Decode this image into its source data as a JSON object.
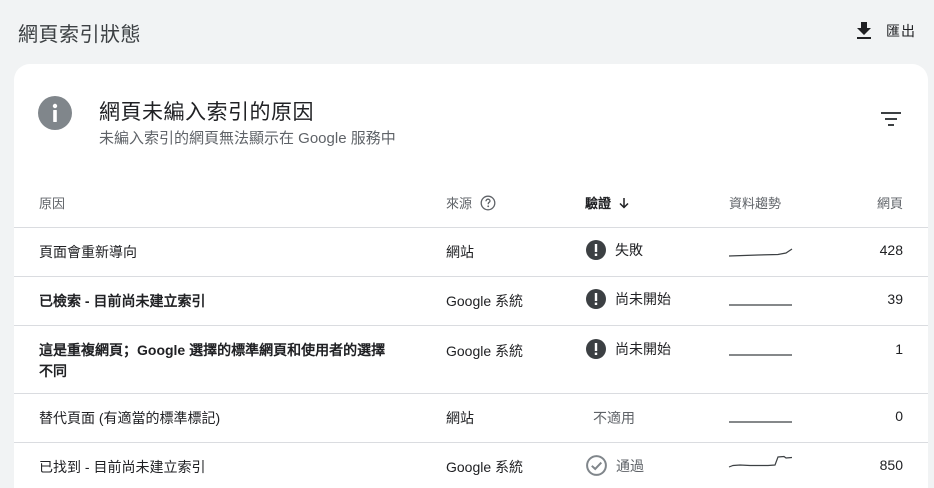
{
  "header": {
    "title": "網頁索引狀態",
    "export_label": "匯出"
  },
  "card": {
    "title": "網頁未編入索引的原因",
    "subtitle": "未編入索引的網頁無法顯示在 Google 服務中"
  },
  "table": {
    "columns": {
      "reason": "原因",
      "source": "來源",
      "verify": "驗證",
      "trend": "資料趨勢",
      "pages": "網頁"
    },
    "rows": [
      {
        "reason": "頁面會重新導向",
        "source": "網站",
        "verify": "失敗",
        "verify_status": "failed",
        "pages": "428",
        "bold": false
      },
      {
        "reason": "已檢索 - 目前尚未建立索引",
        "source": "Google 系統",
        "verify": "尚未開始",
        "verify_status": "not-started",
        "pages": "39",
        "bold": true
      },
      {
        "reason": "這是重複網頁；Google 選擇的標準網頁和使用者的選擇不同",
        "source": "Google 系統",
        "verify": "尚未開始",
        "verify_status": "not-started",
        "pages": "1",
        "bold": true
      },
      {
        "reason": "替代頁面 (有適當的標準標記)",
        "source": "網站",
        "verify": "不適用",
        "verify_status": "not-applicable",
        "pages": "0",
        "bold": false
      },
      {
        "reason": "已找到 - 目前尚未建立索引",
        "source": "Google 系統",
        "verify": "通過",
        "verify_status": "passed",
        "pages": "850",
        "bold": false
      }
    ]
  },
  "icons": {
    "export": "download-icon",
    "info": "info-icon",
    "filter": "filter-icon",
    "help": "help-circle-icon",
    "sort": "arrow-down-icon",
    "failed": "exclamation-circle-icon",
    "passed": "check-circle-icon"
  },
  "colors": {
    "status_dark": "#3c4043",
    "passed_gray": "#80868b",
    "sparkline": "#3c4043"
  }
}
